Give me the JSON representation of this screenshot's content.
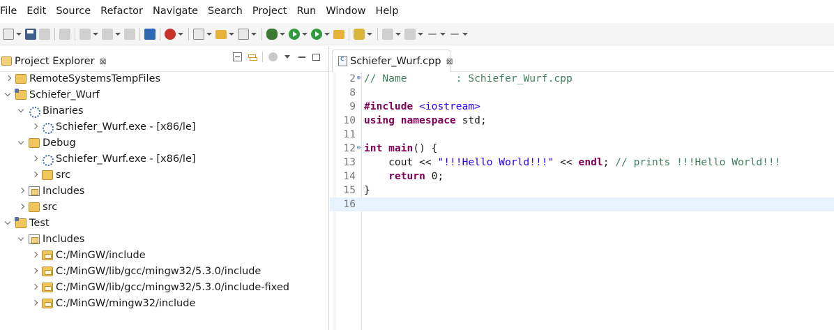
{
  "menu": [
    "File",
    "Edit",
    "Source",
    "Refactor",
    "Navigate",
    "Search",
    "Project",
    "Run",
    "Window",
    "Help"
  ],
  "toolbar": {
    "icons": [
      "new-icon",
      "save-icon",
      "save-all-icon",
      "print-icon",
      "build-icon",
      "build-config-icon",
      "toggle-icon",
      "open-console-icon",
      "stop-icon",
      "new-cpp-project-icon",
      "open-folder-icon",
      "new-class-icon",
      "debug-icon",
      "run-icon",
      "external-tools-icon",
      "open-task-icon",
      "search-icon",
      "next-annotation-icon",
      "prev-annotation-icon",
      "back-icon",
      "forward-icon"
    ]
  },
  "explorer": {
    "tab_label": "Project Explorer",
    "close_glyph": "⊠",
    "tree": [
      {
        "label": "RemoteSystemsTempFiles",
        "level": 0,
        "state": "closed",
        "icon": "folder-icon"
      },
      {
        "label": "Schiefer_Wurf",
        "level": 0,
        "state": "open",
        "icon": "cpp-project-icon"
      },
      {
        "label": "Binaries",
        "level": 1,
        "state": "open",
        "icon": "binaries-icon"
      },
      {
        "label": "Schiefer_Wurf.exe - [x86/le]",
        "level": 2,
        "state": "closed",
        "icon": "exe-icon"
      },
      {
        "label": "Debug",
        "level": 1,
        "state": "open",
        "icon": "folder-icon"
      },
      {
        "label": "Schiefer_Wurf.exe - [x86/le]",
        "level": 2,
        "state": "closed",
        "icon": "exe-icon"
      },
      {
        "label": "src",
        "level": 2,
        "state": "closed",
        "icon": "folder-icon"
      },
      {
        "label": "Includes",
        "level": 1,
        "state": "closed",
        "icon": "includes-icon"
      },
      {
        "label": "src",
        "level": 1,
        "state": "closed",
        "icon": "source-folder-icon"
      },
      {
        "label": "Test",
        "level": 0,
        "state": "open",
        "icon": "cpp-project-icon"
      },
      {
        "label": "Includes",
        "level": 1,
        "state": "open",
        "icon": "includes-icon"
      },
      {
        "label": "C:/MinGW/include",
        "level": 2,
        "state": "closed",
        "icon": "include-path-icon"
      },
      {
        "label": "C:/MinGW/lib/gcc/mingw32/5.3.0/include",
        "level": 2,
        "state": "closed",
        "icon": "include-path-icon"
      },
      {
        "label": "C:/MinGW/lib/gcc/mingw32/5.3.0/include-fixed",
        "level": 2,
        "state": "closed",
        "icon": "include-path-icon"
      },
      {
        "label": "C:/MinGW/mingw32/include",
        "level": 2,
        "state": "closed",
        "icon": "include-path-icon"
      }
    ]
  },
  "editor": {
    "tab_label": "Schiefer_Wurf.cpp",
    "close_glyph": "⊠",
    "fold_expand_glyph": "⊕",
    "fold_collapse_glyph": "⊖",
    "lines": [
      {
        "num": "2",
        "fold": "expand",
        "tokens": [
          {
            "t": "// Name        : Schiefer_Wurf.cpp",
            "c": "cm"
          }
        ]
      },
      {
        "num": "8",
        "tokens": []
      },
      {
        "num": "9",
        "tokens": [
          {
            "t": "#include",
            "c": "kw"
          },
          {
            "t": " ",
            "c": ""
          },
          {
            "t": "<iostream>",
            "c": "inc"
          }
        ]
      },
      {
        "num": "10",
        "tokens": [
          {
            "t": "using",
            "c": "kw"
          },
          {
            "t": " ",
            "c": ""
          },
          {
            "t": "namespace",
            "c": "kw"
          },
          {
            "t": " std;",
            "c": ""
          }
        ]
      },
      {
        "num": "11",
        "tokens": []
      },
      {
        "num": "12",
        "fold": "collapse",
        "tokens": [
          {
            "t": "int",
            "c": "kw"
          },
          {
            "t": " ",
            "c": ""
          },
          {
            "t": "main",
            "c": "kw"
          },
          {
            "t": "() {",
            "c": ""
          }
        ]
      },
      {
        "num": "13",
        "tokens": [
          {
            "t": "    cout << ",
            "c": ""
          },
          {
            "t": "\"!!!Hello World!!!\"",
            "c": "str"
          },
          {
            "t": " << ",
            "c": ""
          },
          {
            "t": "endl",
            "c": "kw"
          },
          {
            "t": "; ",
            "c": ""
          },
          {
            "t": "// prints !!!Hello World!!!",
            "c": "cm"
          }
        ]
      },
      {
        "num": "14",
        "tokens": [
          {
            "t": "    ",
            "c": ""
          },
          {
            "t": "return",
            "c": "kw"
          },
          {
            "t": " 0;",
            "c": ""
          }
        ]
      },
      {
        "num": "15",
        "tokens": [
          {
            "t": "}",
            "c": ""
          }
        ]
      },
      {
        "num": "16",
        "current": true,
        "tokens": []
      }
    ]
  }
}
